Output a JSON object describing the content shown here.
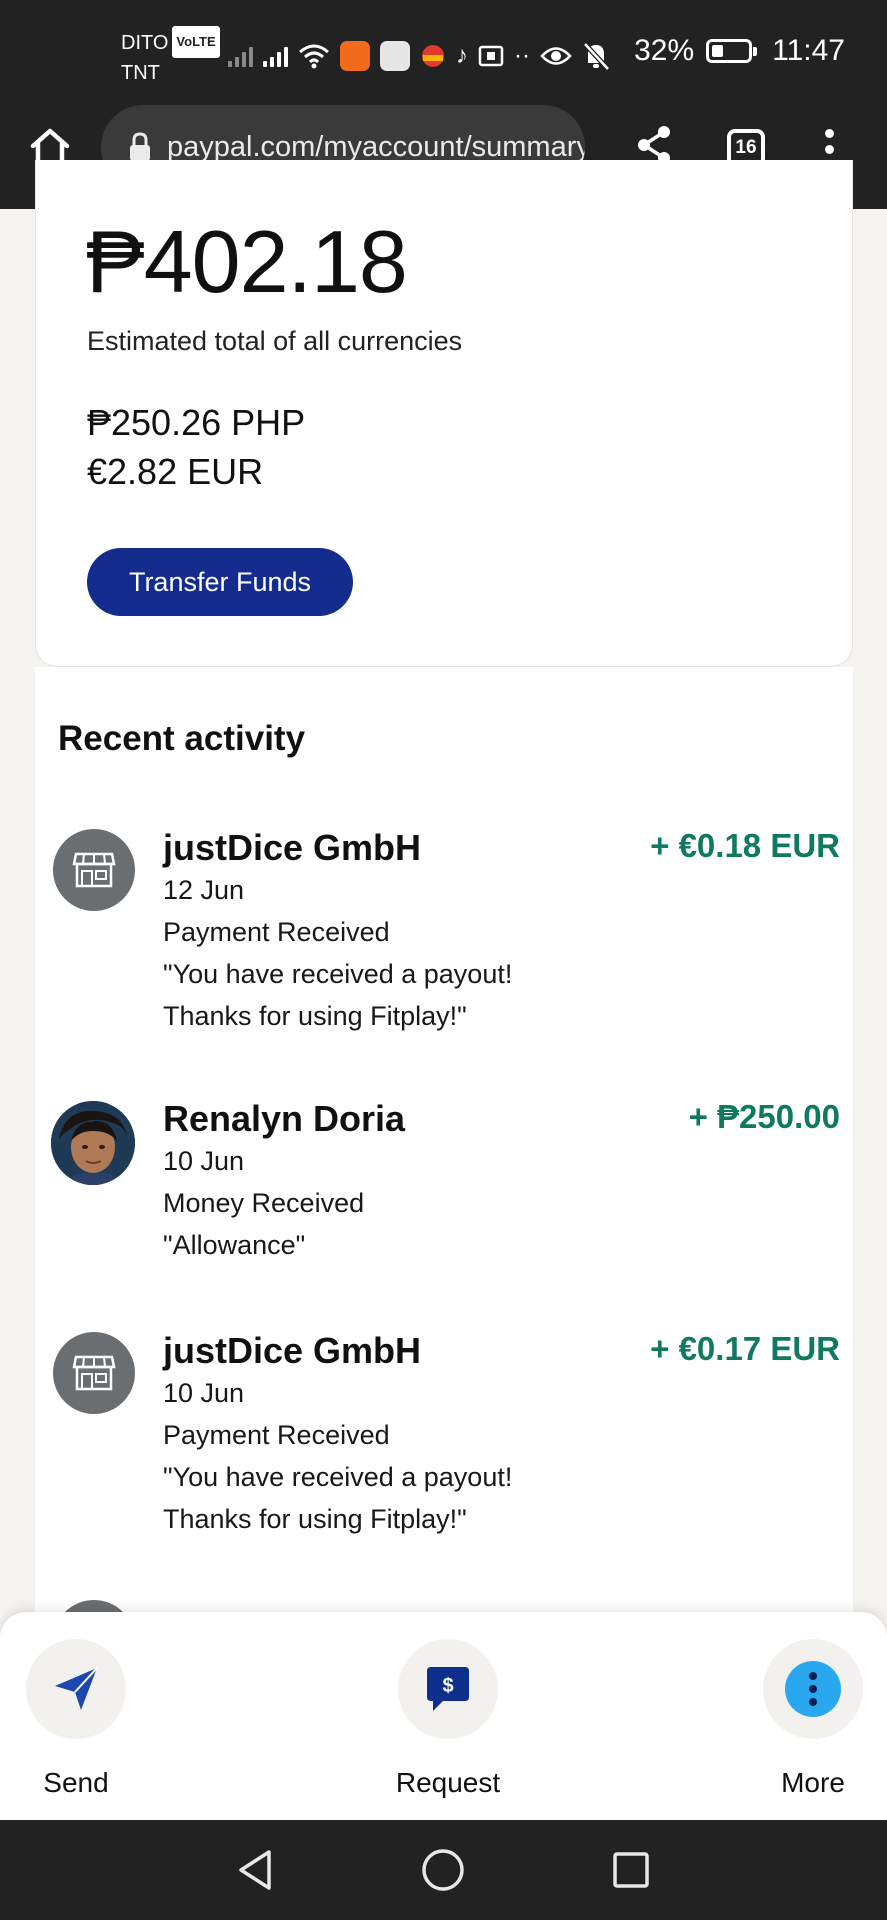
{
  "status_bar": {
    "carrier_top": "DITO",
    "volte_badge": "VoLTE",
    "carrier_bottom": "TNT",
    "battery": "32%",
    "time": "11:47"
  },
  "browser": {
    "url": "paypal.com/myaccount/summary",
    "tab_count": "16"
  },
  "balance": {
    "total": "₱402.18",
    "note": "Estimated total of all currencies",
    "currencies": [
      "₱250.26 PHP",
      "€2.82 EUR"
    ],
    "transfer_label": "Transfer Funds"
  },
  "activity": {
    "title": "Recent activity",
    "transactions": [
      {
        "name": "justDice GmbH",
        "amount": "+ €0.18 EUR",
        "date": "12 Jun",
        "type": "Payment Received",
        "note_line1": "\"You have received a payout!",
        "note_line2": "Thanks for using Fitplay!\"",
        "avatar": "store-icon"
      },
      {
        "name": "Renalyn Doria",
        "amount": "+ ₱250.00",
        "date": "10 Jun",
        "type": "Money Received",
        "note_line1": "\"Allowance\"",
        "avatar": "user-photo"
      },
      {
        "name": "justDice GmbH",
        "amount": "+ €0.17 EUR",
        "date": "10 Jun",
        "type": "Payment Received",
        "note_line1": "\"You have received a payout!",
        "note_line2": "Thanks for using Fitplay!\"",
        "avatar": "store-icon"
      }
    ]
  },
  "actions": {
    "send": "Send",
    "request": "Request",
    "more": "More"
  },
  "colors": {
    "brand_button": "#142c8e",
    "amount_green": "#0f7a5f",
    "more_icon": "#29a8f0",
    "send_icon": "#1a47b0",
    "request_icon": "#0f2f8c"
  }
}
